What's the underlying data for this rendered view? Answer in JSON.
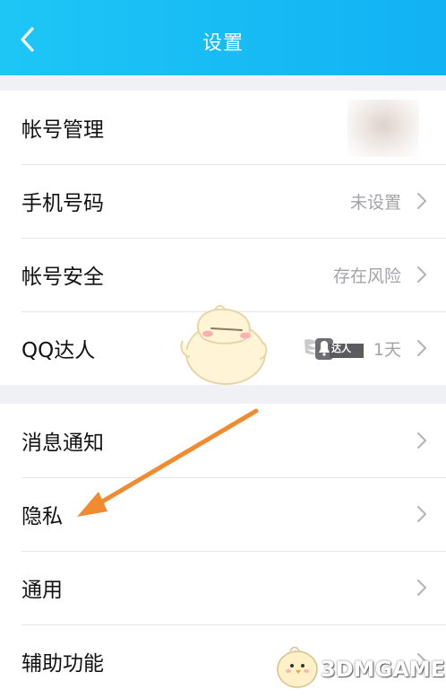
{
  "header": {
    "title": "设置"
  },
  "group1": [
    {
      "label": "帐号管理",
      "value": ""
    },
    {
      "label": "手机号码",
      "value": "未设置"
    },
    {
      "label": "帐号安全",
      "value": "存在风险"
    },
    {
      "label": "QQ达人",
      "value": "1天",
      "badge_text": "达人"
    }
  ],
  "group2": [
    {
      "label": "消息通知"
    },
    {
      "label": "隐私"
    },
    {
      "label": "通用"
    },
    {
      "label": "辅助功能"
    }
  ],
  "watermark": {
    "text": "3DMGAME"
  },
  "colors": {
    "header": "#14b8f4",
    "arrow": "#f28b30",
    "background": "#f0f1f5"
  }
}
